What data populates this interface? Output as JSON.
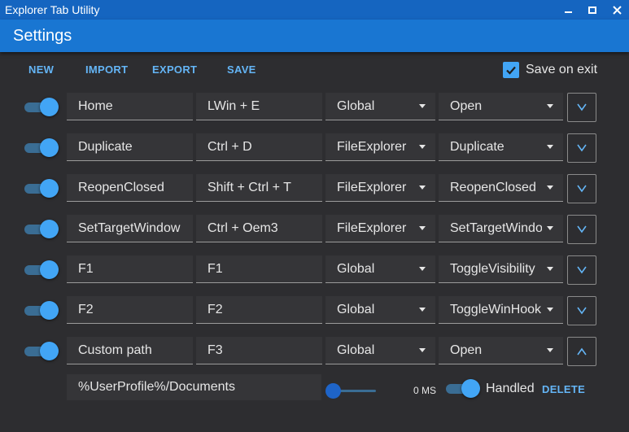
{
  "window": {
    "title": "Explorer Tab Utility"
  },
  "header": {
    "title": "Settings"
  },
  "toolbar": {
    "new_label": "NEW",
    "import_label": "IMPORT",
    "export_label": "EXPORT",
    "save_label": "SAVE",
    "save_on_exit": {
      "label": "Save on exit",
      "checked": true
    }
  },
  "colors": {
    "accent": "#42a5f5",
    "titlebar": "#1565c0",
    "header": "#1976d2",
    "background": "#2d2d30"
  },
  "hotkeys": [
    {
      "enabled": true,
      "name": "Home",
      "keys": "LWin + E",
      "scope": "Global",
      "action": "Open",
      "expanded": false,
      "expand_icon": "chevron-down-icon"
    },
    {
      "enabled": true,
      "name": "Duplicate",
      "keys": "Ctrl + D",
      "scope": "FileExplorer",
      "action": "Duplicate",
      "expanded": false,
      "expand_icon": "chevron-down-icon"
    },
    {
      "enabled": true,
      "name": "ReopenClosed",
      "keys": "Shift + Ctrl + T",
      "scope": "FileExplorer",
      "action": "ReopenClosed",
      "expanded": false,
      "expand_icon": "chevron-down-icon"
    },
    {
      "enabled": true,
      "name": "SetTargetWindow",
      "keys": "Ctrl + Oem3",
      "scope": "FileExplorer",
      "action": "SetTargetWindow",
      "expanded": false,
      "expand_icon": "chevron-down-icon"
    },
    {
      "enabled": true,
      "name": "F1",
      "keys": "F1",
      "scope": "Global",
      "action": "ToggleVisibility",
      "expanded": false,
      "expand_icon": "chevron-down-icon"
    },
    {
      "enabled": true,
      "name": "F2",
      "keys": "F2",
      "scope": "Global",
      "action": "ToggleWinHook",
      "expanded": false,
      "expand_icon": "chevron-down-icon"
    },
    {
      "enabled": true,
      "name": "Custom path",
      "keys": "F3",
      "scope": "Global",
      "action": "Open",
      "expanded": true,
      "expand_icon": "chevron-up-icon"
    }
  ],
  "details": {
    "path": "%UserProfile%/Documents",
    "delay_value": 0,
    "delay_label": "0 MS",
    "handled": {
      "label": "Handled",
      "on": true
    },
    "delete_label": "DELETE"
  }
}
